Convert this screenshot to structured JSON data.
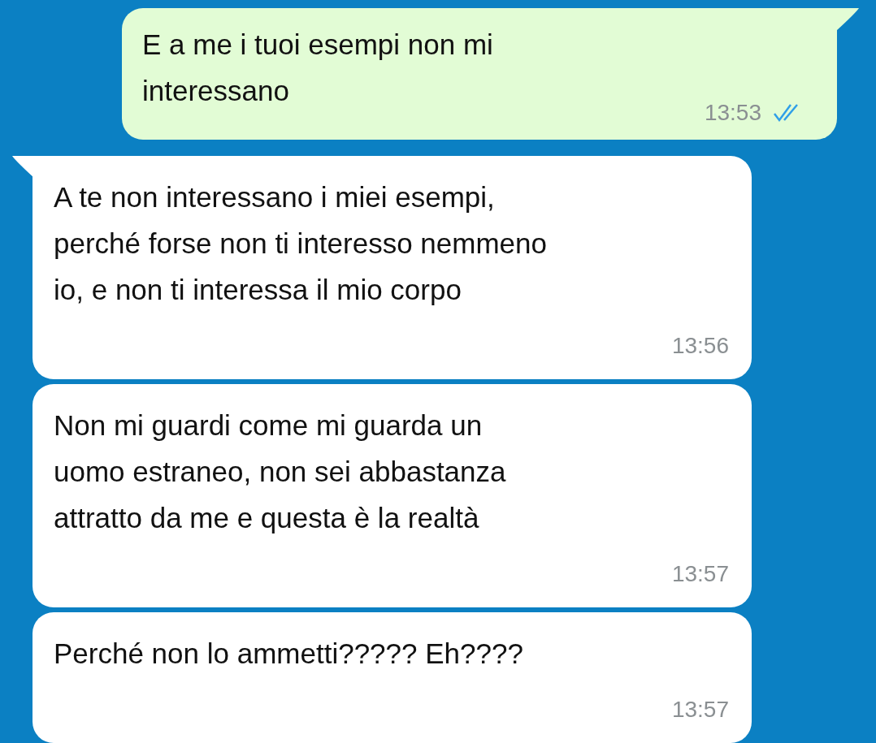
{
  "messages": [
    {
      "kind": "outgoing",
      "tail": true,
      "text": "E a me i tuoi esempi non mi\ninteressano",
      "time": "13:53",
      "read": true
    },
    {
      "kind": "incoming",
      "tail": true,
      "text": "A te non interessano i miei esempi,\nperché forse non ti interesso nemmeno\nio, e non ti interessa il mio corpo",
      "time": "13:56"
    },
    {
      "kind": "incoming",
      "tail": false,
      "text": "Non mi guardi come mi guarda un\nuomo estraneo, non sei abbastanza\nattratto da me e questa è la realtà",
      "time": "13:57"
    },
    {
      "kind": "incoming",
      "tail": false,
      "text": "Perché non lo ammetti????? Eh????",
      "time": "13:57"
    }
  ]
}
